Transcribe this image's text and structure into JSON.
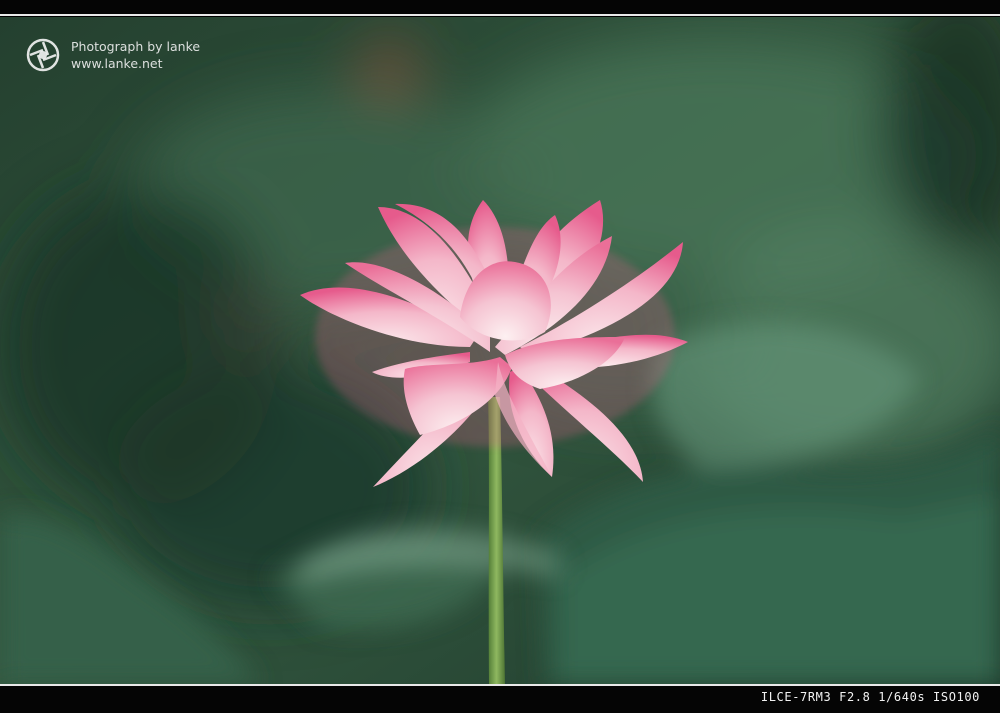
{
  "watermark": {
    "line1": "Photograph by lanke",
    "line2": "www.lanke.net",
    "logo_icon": "aperture-icon"
  },
  "exif": {
    "text": "ILCE-7RM3 F2.8 1/640s ISO100"
  },
  "colors": {
    "frame": "#050505",
    "frame_line": "#e9e9e9",
    "background_green": "#2c4f3c",
    "petal_pink": "#e8608f",
    "stem_green": "#6f9a4a"
  }
}
